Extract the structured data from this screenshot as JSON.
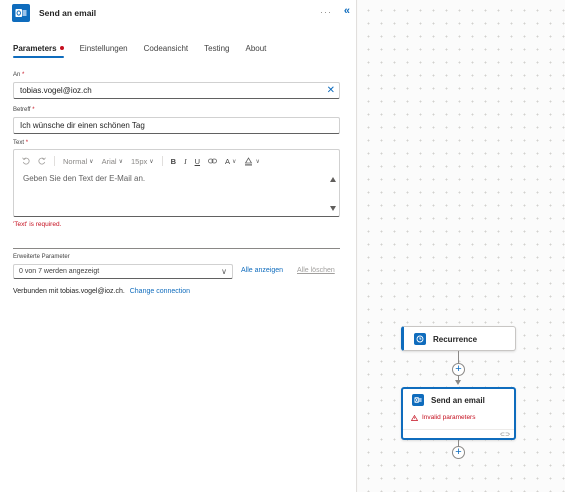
{
  "header": {
    "title": "Send an email",
    "more_label": "···",
    "collapse_label": "«"
  },
  "tabs": [
    {
      "label": "Parameters"
    },
    {
      "label": "Einstellungen"
    },
    {
      "label": "Codeansicht"
    },
    {
      "label": "Testing"
    },
    {
      "label": "About"
    }
  ],
  "fields": {
    "to": {
      "label": "An",
      "required": "*",
      "value": "tobias.vogel@ioz.ch"
    },
    "subject": {
      "label": "Betreff",
      "required": "*",
      "value": "Ich wünsche dir einen schönen Tag"
    },
    "body": {
      "label": "Text",
      "required": "*",
      "placeholder": "Geben Sie den Text der E-Mail an.",
      "error": "'Text' is required."
    }
  },
  "toolbar": {
    "format": "Normal",
    "font": "Arial",
    "size": "15px",
    "bold": "B",
    "italic": "I",
    "underline": "U",
    "font_color": "A"
  },
  "advanced": {
    "label": "Erweiterte Parameter",
    "select_value": "0 von 7 werden angezeigt",
    "show_all": "Alle anzeigen",
    "clear_all": "Alle löschen"
  },
  "connection": {
    "text": "Verbunden mit tobias.vogel@ioz.ch.",
    "change_link": "Change connection"
  },
  "canvas": {
    "nodes": [
      {
        "title": "Recurrence",
        "icon": "clock-icon"
      },
      {
        "title": "Send an email",
        "icon": "outlook-icon",
        "status": "Invalid parameters"
      }
    ]
  },
  "colors": {
    "accent": "#0f6cbd",
    "error": "#c50f1f"
  }
}
